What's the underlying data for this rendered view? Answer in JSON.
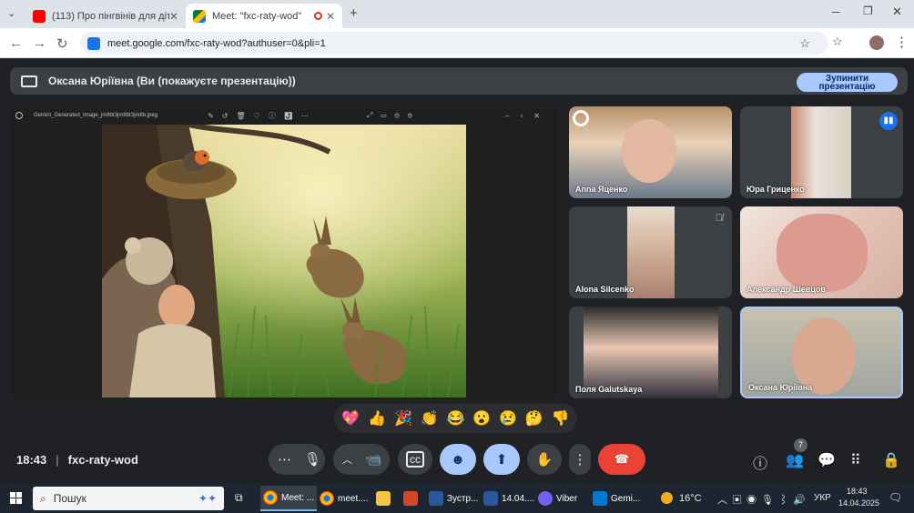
{
  "browser": {
    "tabs": [
      {
        "title": "(113) Про пінгвінів для дітей -",
        "icon": "youtube-icon"
      },
      {
        "title": "Meet: \"fxc-raty-wod\"",
        "icon": "google-meet-icon"
      }
    ],
    "url": "meet.google.com/fxc-raty-wod?authuser=0&pli=1"
  },
  "meet": {
    "banner_text": "Оксана Юріївна (Ви (покажуєте презентацію))",
    "stop_button": "Зупинити презентацію",
    "viewer_filename": "Gemini_Generated_Image_jm8bt3jm8bt3jm8b.jpeg",
    "participants": [
      {
        "name": "Anna Яценко"
      },
      {
        "name": "Юра Гриценко"
      },
      {
        "name": "Alona Silcenko"
      },
      {
        "name": "Александр Шевцов"
      },
      {
        "name": "Поля Galutskaya"
      },
      {
        "name": "Оксана Юріївна"
      }
    ],
    "reactions": [
      "💖",
      "👍",
      "🎉",
      "👏",
      "😂",
      "😮",
      "😢",
      "🤔",
      "👎"
    ],
    "time": "18:43",
    "meeting_code": "fxc-raty-wod",
    "people_count": "7"
  },
  "taskbar": {
    "search_placeholder": "Пошук",
    "apps": [
      {
        "label": "Meet: ..."
      },
      {
        "label": "meet...."
      },
      {
        "label": "Зустр..."
      },
      {
        "label": "14.04...."
      },
      {
        "label": "Viber"
      },
      {
        "label": "Gemi..."
      }
    ],
    "weather": "16°C",
    "language": "УКР",
    "clock_time": "18:43",
    "clock_date": "14.04.2025"
  }
}
